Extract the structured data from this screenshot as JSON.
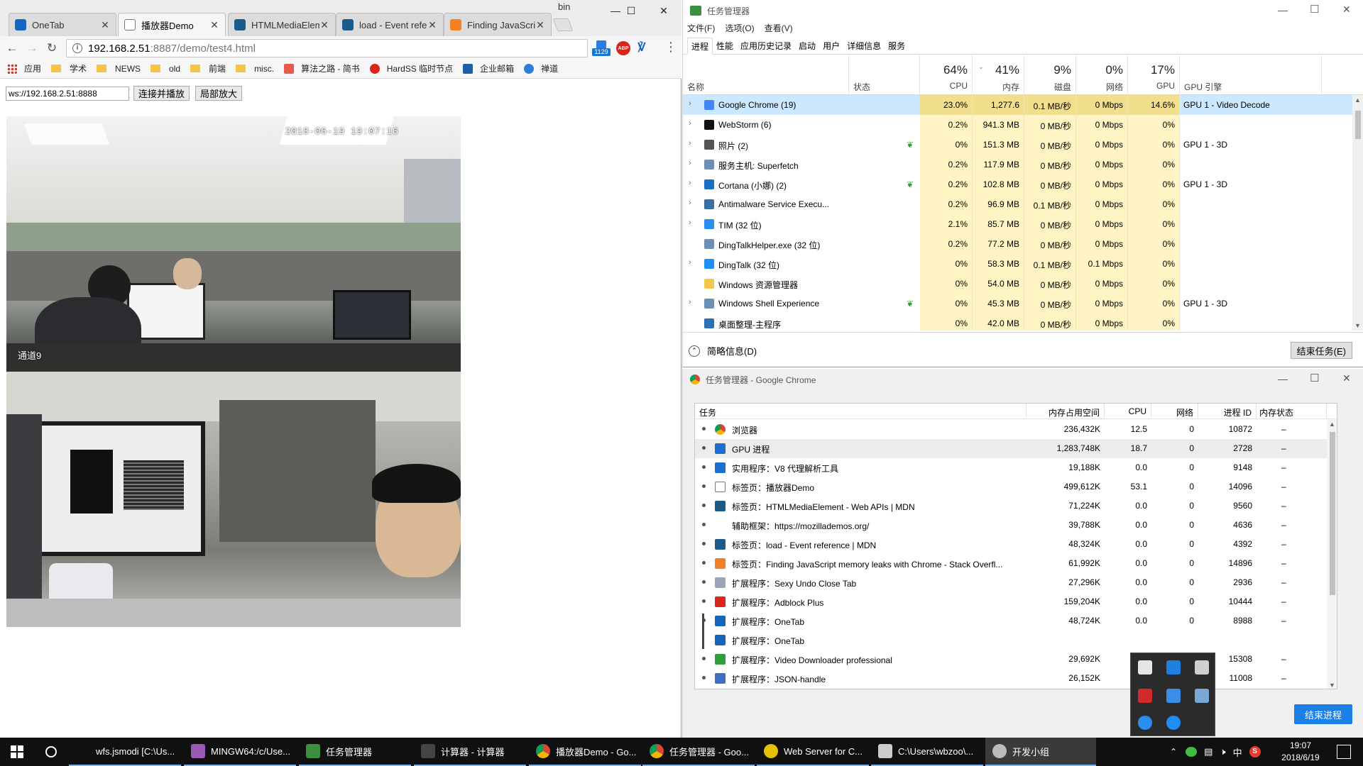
{
  "chrome": {
    "tabs": [
      {
        "label": "OneTab",
        "icon": "onetab-icon",
        "color": "#1565c0"
      },
      {
        "label": "播放器Demo",
        "icon": "page-icon",
        "color": "#ffffff",
        "active": true
      },
      {
        "label": "HTMLMediaElem",
        "icon": "mdn-icon",
        "color": "#1a5b8a"
      },
      {
        "label": "load - Event refe",
        "icon": "mdn-icon",
        "color": "#1a5b8a"
      },
      {
        "label": "Finding JavaScri",
        "icon": "stackoverflow-icon",
        "color": "#f48024"
      }
    ],
    "profile_label": "bin",
    "url_host": "192.168.2.51",
    "url_path": ":8887/demo/test4.html",
    "ext_badge": "1129",
    "ext_abp": "ABP",
    "bookmarks": [
      {
        "label": "应用",
        "kind": "apps"
      },
      {
        "label": "学术",
        "kind": "folder"
      },
      {
        "label": "NEWS",
        "kind": "folder"
      },
      {
        "label": "old",
        "kind": "folder"
      },
      {
        "label": "前端",
        "kind": "folder"
      },
      {
        "label": "misc.",
        "kind": "folder"
      },
      {
        "label": "算法之路 - 简书",
        "kind": "jianshu"
      },
      {
        "label": "HardSS 临时节点",
        "kind": "red"
      },
      {
        "label": "企业邮箱",
        "kind": "mail"
      },
      {
        "label": "禅道",
        "kind": "zentao"
      }
    ],
    "page": {
      "ws_value": "ws://192.168.2.51:8888",
      "connect_button": "连接并播放",
      "zoom_button": "局部放大",
      "video_timestamp": "2018-06-19 19:07:16",
      "video_channel": "通道9"
    }
  },
  "taskmgr": {
    "title": "任务管理器",
    "menu": [
      "文件(F)",
      "选项(O)",
      "查看(V)"
    ],
    "tabs": [
      "进程",
      "性能",
      "应用历史记录",
      "启动",
      "用户",
      "详细信息",
      "服务"
    ],
    "columns": {
      "name": "名称",
      "status": "状态",
      "cpu": {
        "pct": "64%",
        "label": "CPU"
      },
      "mem": {
        "pct": "41%",
        "label": "内存"
      },
      "disk": {
        "pct": "9%",
        "label": "磁盘"
      },
      "net": {
        "pct": "0%",
        "label": "网络"
      },
      "gpu": {
        "pct": "17%",
        "label": "GPU"
      },
      "gpu_engine": "GPU 引擎"
    },
    "rows": [
      {
        "name": "Google Chrome (19)",
        "icon": "chrome-icon",
        "color": "#4285f4",
        "cpu": "23.0%",
        "mem": "1,277.6",
        "disk": "0.1 MB/秒",
        "net": "0 Mbps",
        "gpu": "14.6%",
        "engine": "GPU 1 - Video Decode",
        "selected": true
      },
      {
        "name": "WebStorm (6)",
        "icon": "webstorm-icon",
        "color": "#111111",
        "cpu": "0.2%",
        "mem": "941.3 MB",
        "disk": "0 MB/秒",
        "net": "0 Mbps",
        "gpu": "0%",
        "engine": ""
      },
      {
        "name": "照片 (2)",
        "icon": "photos-icon",
        "color": "#555555",
        "cpu": "0%",
        "mem": "151.3 MB",
        "disk": "0 MB/秒",
        "net": "0 Mbps",
        "gpu": "0%",
        "engine": "GPU 1 - 3D",
        "leaf": true
      },
      {
        "name": "服务主机: Superfetch",
        "icon": "service-icon",
        "color": "#6b8fb5",
        "cpu": "0.2%",
        "mem": "117.9 MB",
        "disk": "0 MB/秒",
        "net": "0 Mbps",
        "gpu": "0%",
        "engine": ""
      },
      {
        "name": "Cortana (小娜) (2)",
        "icon": "cortana-icon",
        "color": "#1a6fc9",
        "cpu": "0.2%",
        "mem": "102.8 MB",
        "disk": "0 MB/秒",
        "net": "0 Mbps",
        "gpu": "0%",
        "engine": "GPU 1 - 3D",
        "leaf": true
      },
      {
        "name": "Antimalware Service Execu...",
        "icon": "defender-icon",
        "color": "#3b6ea5",
        "cpu": "0.2%",
        "mem": "96.9 MB",
        "disk": "0.1 MB/秒",
        "net": "0 Mbps",
        "gpu": "0%",
        "engine": ""
      },
      {
        "name": "TIM (32 位)",
        "icon": "tim-icon",
        "color": "#2a8df0",
        "cpu": "2.1%",
        "mem": "85.7 MB",
        "disk": "0 MB/秒",
        "net": "0 Mbps",
        "gpu": "0%",
        "engine": ""
      },
      {
        "name": "DingTalkHelper.exe (32 位)",
        "icon": "app-icon",
        "color": "#6b8fb5",
        "cpu": "0.2%",
        "mem": "77.2 MB",
        "disk": "0 MB/秒",
        "net": "0 Mbps",
        "gpu": "0%",
        "engine": ""
      },
      {
        "name": "DingTalk (32 位)",
        "icon": "dingtalk-icon",
        "color": "#1d8ff2",
        "cpu": "0%",
        "mem": "58.3 MB",
        "disk": "0.1 MB/秒",
        "net": "0.1 Mbps",
        "gpu": "0%",
        "engine": ""
      },
      {
        "name": "Windows 资源管理器",
        "icon": "explorer-icon",
        "color": "#f2c94c",
        "cpu": "0%",
        "mem": "54.0 MB",
        "disk": "0 MB/秒",
        "net": "0 Mbps",
        "gpu": "0%",
        "engine": ""
      },
      {
        "name": "Windows Shell Experience",
        "icon": "shell-icon",
        "color": "#6b8fb5",
        "cpu": "0%",
        "mem": "45.3 MB",
        "disk": "0 MB/秒",
        "net": "0 Mbps",
        "gpu": "0%",
        "engine": "GPU 1 - 3D",
        "leaf": true
      },
      {
        "name": "桌面整理-主程序",
        "icon": "desktop-icon",
        "color": "#2f6fb5",
        "cpu": "0%",
        "mem": "42.0 MB",
        "disk": "0 MB/秒",
        "net": "0 Mbps",
        "gpu": "0%",
        "engine": ""
      }
    ],
    "fewer_details": "简略信息(D)",
    "end_task": "结束任务(E)"
  },
  "chrome_taskmgr": {
    "title": "任务管理器 - Google Chrome",
    "columns": [
      "任务",
      "内存占用空间",
      "CPU",
      "网络",
      "进程 ID",
      "内存状态"
    ],
    "rows": [
      {
        "name": "浏览器",
        "icon": "chrome-icon",
        "color": "#4285f4",
        "mem": "236,432K",
        "cpu": "12.5",
        "net": "0",
        "pid": "10872",
        "state": "–"
      },
      {
        "name": "GPU 进程",
        "icon": "puzzle-icon",
        "color": "#1a6fd1",
        "mem": "1,283,748K",
        "cpu": "18.7",
        "net": "0",
        "pid": "2728",
        "state": "–",
        "selected": true
      },
      {
        "name": "实用程序：V8 代理解析工具",
        "icon": "puzzle-icon",
        "color": "#1a6fd1",
        "mem": "19,188K",
        "cpu": "0.0",
        "net": "0",
        "pid": "9148",
        "state": "–"
      },
      {
        "name": "标签页：播放器Demo",
        "icon": "page-icon",
        "color": "#ffffff",
        "mem": "499,612K",
        "cpu": "53.1",
        "net": "0",
        "pid": "14096",
        "state": "–"
      },
      {
        "name": "标签页：HTMLMediaElement - Web APIs | MDN",
        "icon": "mdn-icon",
        "color": "#1a5b8a",
        "mem": "71,224K",
        "cpu": "0.0",
        "net": "0",
        "pid": "9560",
        "state": "–"
      },
      {
        "name": "辅助框架：https://mozillademos.org/",
        "icon": "",
        "color": "",
        "mem": "39,788K",
        "cpu": "0.0",
        "net": "0",
        "pid": "4636",
        "state": "–"
      },
      {
        "name": "标签页：load - Event reference | MDN",
        "icon": "mdn-icon",
        "color": "#1a5b8a",
        "mem": "48,324K",
        "cpu": "0.0",
        "net": "0",
        "pid": "4392",
        "state": "–"
      },
      {
        "name": "标签页：Finding JavaScript memory leaks with Chrome - Stack Overfl...",
        "icon": "stackoverflow-icon",
        "color": "#f48024",
        "mem": "61,992K",
        "cpu": "0.0",
        "net": "0",
        "pid": "14896",
        "state": "–"
      },
      {
        "name": "扩展程序：Sexy Undo Close Tab",
        "icon": "undo-icon",
        "color": "#9aa6b8",
        "mem": "27,296K",
        "cpu": "0.0",
        "net": "0",
        "pid": "2936",
        "state": "–"
      },
      {
        "name": "扩展程序：Adblock Plus",
        "icon": "abp-icon",
        "color": "#d9261c",
        "mem": "159,204K",
        "cpu": "0.0",
        "net": "0",
        "pid": "10444",
        "state": "–"
      },
      {
        "name": "扩展程序：OneTab",
        "icon": "onetab-icon",
        "color": "#1565c0",
        "mem": "48,724K",
        "cpu": "0.0",
        "net": "0",
        "pid": "8988",
        "state": "–"
      },
      {
        "name": "扩展程序：OneTab",
        "icon": "onetab-icon",
        "color": "#1565c0",
        "mem": "",
        "cpu": "",
        "net": "",
        "pid": "",
        "state": "",
        "nodot": true
      },
      {
        "name": "扩展程序：Video Downloader professional",
        "icon": "download-icon",
        "color": "#2e9e3a",
        "mem": "29,692K",
        "cpu": "",
        "net": "",
        "pid": "15308",
        "state": "–"
      },
      {
        "name": "扩展程序：JSON-handle",
        "icon": "json-icon",
        "color": "#3d6fc4",
        "mem": "26,152K",
        "cpu": "",
        "net": "",
        "pid": "11008",
        "state": "–"
      }
    ],
    "end_process": "结束进程"
  },
  "tray_popup": [
    {
      "icon": "tray-app-icon-1",
      "color": "#e6e6e6"
    },
    {
      "icon": "tray-app-icon-2",
      "color": "#1e7fe0"
    },
    {
      "icon": "tray-app-icon-3",
      "color": "#cfcfcf"
    },
    {
      "icon": "tray-app-icon-4",
      "color": "#d12a2a"
    },
    {
      "icon": "tray-app-icon-5",
      "color": "#3a8ee6"
    },
    {
      "icon": "tray-app-icon-6",
      "color": "#7aa7d6"
    },
    {
      "icon": "tray-app-icon-7",
      "color": "#2a8df0"
    },
    {
      "icon": "tray-app-icon-8",
      "color": "#1d8ff2"
    }
  ],
  "taskbar": {
    "items": [
      {
        "label": "wfs.jsmodi [C:\\Us...",
        "icon": "webstorm-icon",
        "color": "#111111"
      },
      {
        "label": "MINGW64:/c/Use...",
        "icon": "git-icon",
        "color": "#9b59b6"
      },
      {
        "label": "任务管理器",
        "icon": "taskmgr-icon",
        "color": "#3c8f3c"
      },
      {
        "label": "计算器 - 计算器",
        "icon": "calculator-icon",
        "color": "#444444"
      },
      {
        "label": "播放器Demo - Go...",
        "icon": "chrome-icon",
        "color": "#4285f4"
      },
      {
        "label": "任务管理器 - Goo...",
        "icon": "chrome-icon",
        "color": "#4285f4"
      },
      {
        "label": "Web Server for C...",
        "icon": "webserver-icon",
        "color": "#e5c100"
      },
      {
        "label": "C:\\Users\\wbzoo\\...",
        "icon": "terminal-icon",
        "color": "#cccccc"
      },
      {
        "label": "开发小组",
        "icon": "group-chat-icon",
        "color": "#bbbbbb",
        "active": true
      }
    ],
    "ime": "中",
    "time": "19:07",
    "date": "2018/6/19"
  }
}
